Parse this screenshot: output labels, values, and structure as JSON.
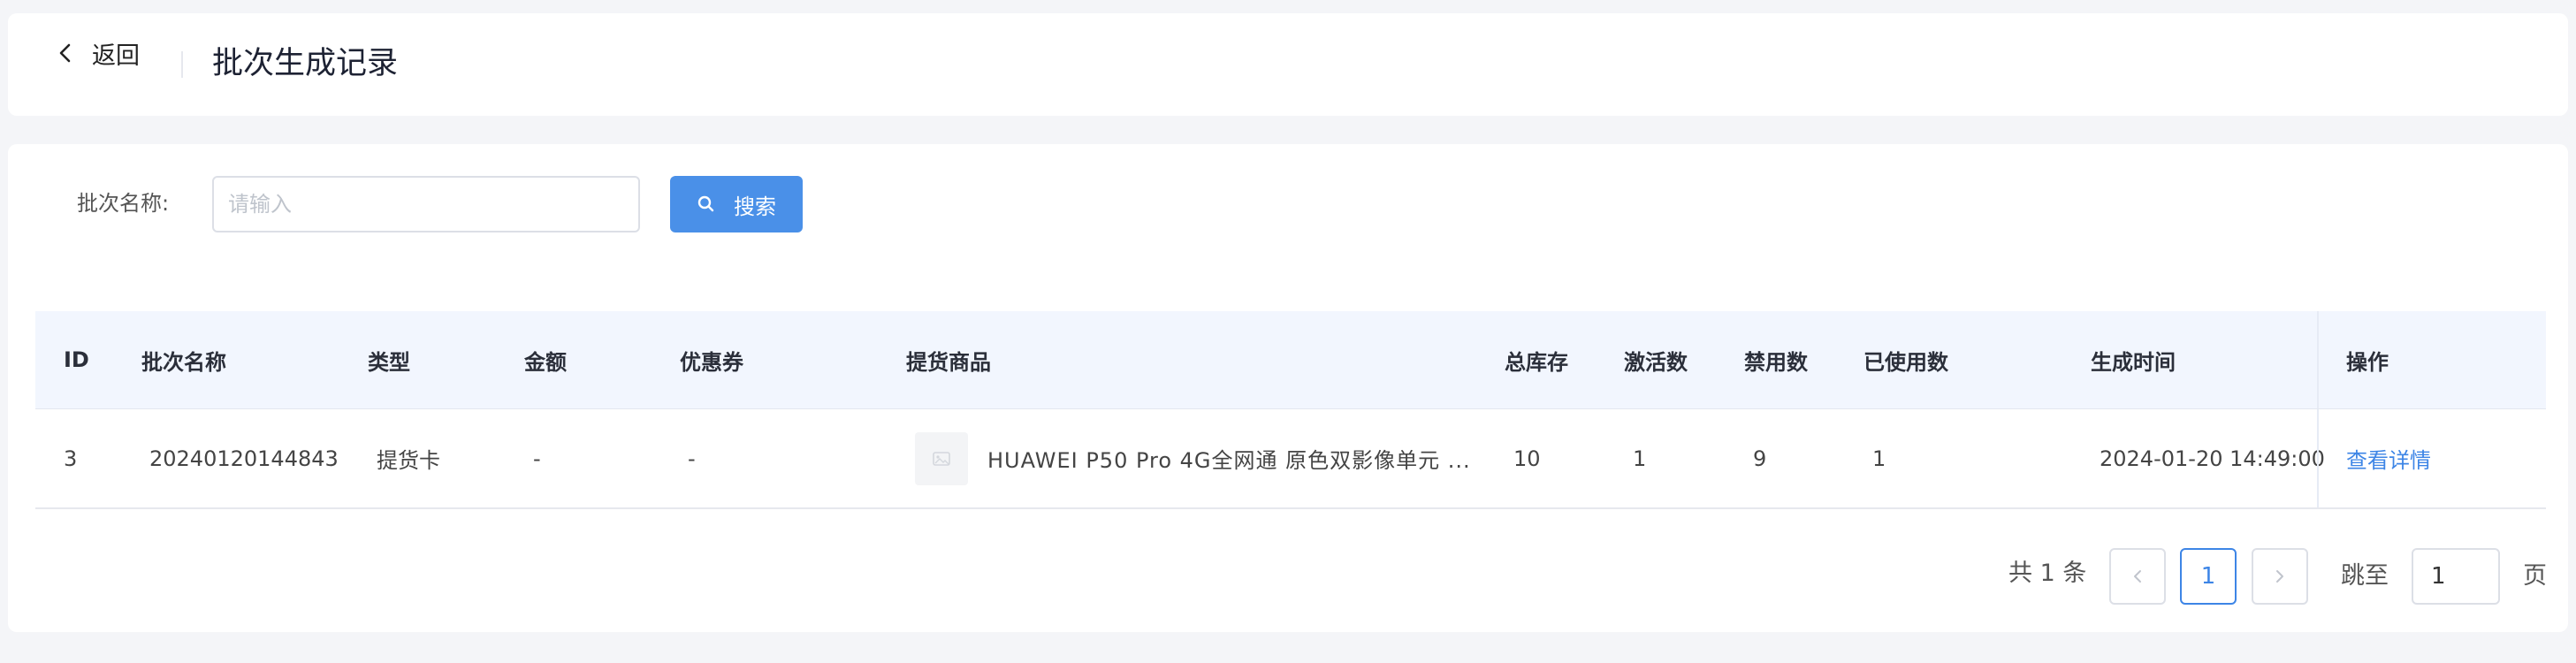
{
  "header": {
    "back_label": "返回",
    "title": "批次生成记录"
  },
  "filter": {
    "label": "批次名称:",
    "placeholder": "请输入",
    "value": "",
    "search_label": "搜索"
  },
  "table": {
    "columns": {
      "id": "ID",
      "batch_name": "批次名称",
      "type": "类型",
      "amount": "金额",
      "coupon": "优惠券",
      "goods": "提货商品",
      "total_stock": "总库存",
      "activated": "激活数",
      "disabled": "禁用数",
      "used": "已使用数",
      "created_at": "生成时间",
      "actions": "操作"
    },
    "rows": [
      {
        "id": "3",
        "batch_name": "20240120144843",
        "type": "提货卡",
        "amount": "-",
        "coupon": "-",
        "goods": "HUAWEI P50 Pro 4G全网通 原色双影像单元 ...",
        "total_stock": "10",
        "activated": "1",
        "disabled": "9",
        "used": "1",
        "created_at": "2024-01-20 14:49:00",
        "action": "查看详情"
      }
    ]
  },
  "pagination": {
    "total_text": "共 1 条",
    "current_page": "1",
    "jump_label": "跳至",
    "jump_value": "1",
    "page_suffix": "页"
  },
  "icons": {
    "back": "chevron-left-icon",
    "search": "search-icon",
    "prev": "chevron-left-icon",
    "next": "chevron-right-icon",
    "thumb": "image-placeholder-icon"
  },
  "colors": {
    "accent": "#4a90e8",
    "link": "#3d85e6",
    "page_bg": "#f4f5f8",
    "table_header_bg": "#f2f6fe"
  }
}
